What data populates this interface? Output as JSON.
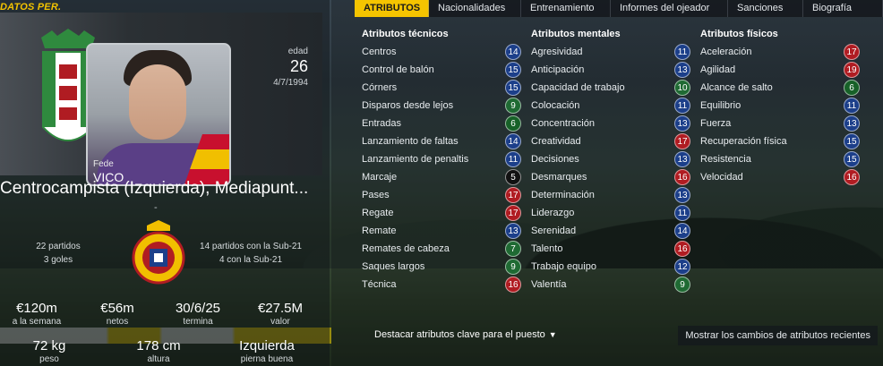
{
  "left": {
    "section_label": "DATOS PER.",
    "player": {
      "first_name": "Fede",
      "last_name": "VICO",
      "age_label": "edad",
      "age": "26",
      "dob": "4/7/1994",
      "position": "Centrocampista (Izquierda), Mediapunt...",
      "dash": "-"
    },
    "club_stats": {
      "line1": "22 partidos",
      "line2": "3 goles"
    },
    "intl_stats": {
      "line1": "14 partidos con la Sub-21",
      "line2": "4 con la Sub-21"
    },
    "contract": [
      {
        "value": "€120m",
        "label": "a la semana"
      },
      {
        "value": "€56m",
        "label": "netos"
      },
      {
        "value": "30/6/25",
        "label": "termina"
      },
      {
        "value": "€27.5M",
        "label": "valor"
      }
    ],
    "physical": [
      {
        "value": "72 kg",
        "label": "peso"
      },
      {
        "value": "178 cm",
        "label": "altura"
      },
      {
        "value": "Izquierda",
        "label": "pierna buena"
      }
    ]
  },
  "tabs": [
    "ATRIBUTOS",
    "Nacionalidades",
    "Entrenamiento",
    "Informes del ojeador",
    "Sanciones",
    "Biografía"
  ],
  "active_tab": 0,
  "attributes": {
    "technical": {
      "title": "Atributos técnicos",
      "items": [
        {
          "name": "Centros",
          "value": "14",
          "color": "#1c3f8a"
        },
        {
          "name": "Control de balón",
          "value": "15",
          "color": "#1c3f8a"
        },
        {
          "name": "Córners",
          "value": "15",
          "color": "#1c3f8a"
        },
        {
          "name": "Disparos desde lejos",
          "value": "9",
          "color": "#1f6a33"
        },
        {
          "name": "Entradas",
          "value": "6",
          "color": "#176128"
        },
        {
          "name": "Lanzamiento de faltas",
          "value": "14",
          "color": "#1c3f8a"
        },
        {
          "name": "Lanzamiento de penaltis",
          "value": "11",
          "color": "#1c3f8a"
        },
        {
          "name": "Marcaje",
          "value": "5",
          "color": "#111111"
        },
        {
          "name": "Pases",
          "value": "17",
          "color": "#b01c22"
        },
        {
          "name": "Regate",
          "value": "17",
          "color": "#b01c22"
        },
        {
          "name": "Remate",
          "value": "13",
          "color": "#1c3f8a"
        },
        {
          "name": "Remates de cabeza",
          "value": "7",
          "color": "#1f6a33"
        },
        {
          "name": "Saques largos",
          "value": "9",
          "color": "#1f6a33"
        },
        {
          "name": "Técnica",
          "value": "16",
          "color": "#b01c22"
        }
      ]
    },
    "mental": {
      "title": "Atributos mentales",
      "items": [
        {
          "name": "Agresividad",
          "value": "11",
          "color": "#1c3f8a"
        },
        {
          "name": "Anticipación",
          "value": "13",
          "color": "#1c3f8a"
        },
        {
          "name": "Capacidad de trabajo",
          "value": "10",
          "color": "#1f6a33"
        },
        {
          "name": "Colocación",
          "value": "11",
          "color": "#1c3f8a"
        },
        {
          "name": "Concentración",
          "value": "13",
          "color": "#1c3f8a"
        },
        {
          "name": "Creatividad",
          "value": "17",
          "color": "#b01c22"
        },
        {
          "name": "Decisiones",
          "value": "13",
          "color": "#1c3f8a"
        },
        {
          "name": "Desmarques",
          "value": "16",
          "color": "#b01c22"
        },
        {
          "name": "Determinación",
          "value": "13",
          "color": "#1c3f8a"
        },
        {
          "name": "Liderazgo",
          "value": "11",
          "color": "#1c3f8a"
        },
        {
          "name": "Serenidad",
          "value": "14",
          "color": "#1c3f8a"
        },
        {
          "name": "Talento",
          "value": "16",
          "color": "#b01c22"
        },
        {
          "name": "Trabajo equipo",
          "value": "12",
          "color": "#1c3f8a"
        },
        {
          "name": "Valentía",
          "value": "9",
          "color": "#1f6a33"
        }
      ]
    },
    "physical": {
      "title": "Atributos físicos",
      "items": [
        {
          "name": "Aceleración",
          "value": "17",
          "color": "#b01c22"
        },
        {
          "name": "Agilidad",
          "value": "19",
          "color": "#b01c22"
        },
        {
          "name": "Alcance de salto",
          "value": "6",
          "color": "#176128"
        },
        {
          "name": "Equilibrio",
          "value": "11",
          "color": "#1c3f8a"
        },
        {
          "name": "Fuerza",
          "value": "13",
          "color": "#1c3f8a"
        },
        {
          "name": "Recuperación física",
          "value": "15",
          "color": "#1c3f8a"
        },
        {
          "name": "Resistencia",
          "value": "15",
          "color": "#1c3f8a"
        },
        {
          "name": "Velocidad",
          "value": "16",
          "color": "#b01c22"
        }
      ]
    }
  },
  "bottom": {
    "highlight_label": "Destacar atributos clave para el puesto",
    "show_changes_label": "Mostrar los cambios de atributos recientes"
  },
  "colors": {
    "accent": "#f5c400"
  }
}
